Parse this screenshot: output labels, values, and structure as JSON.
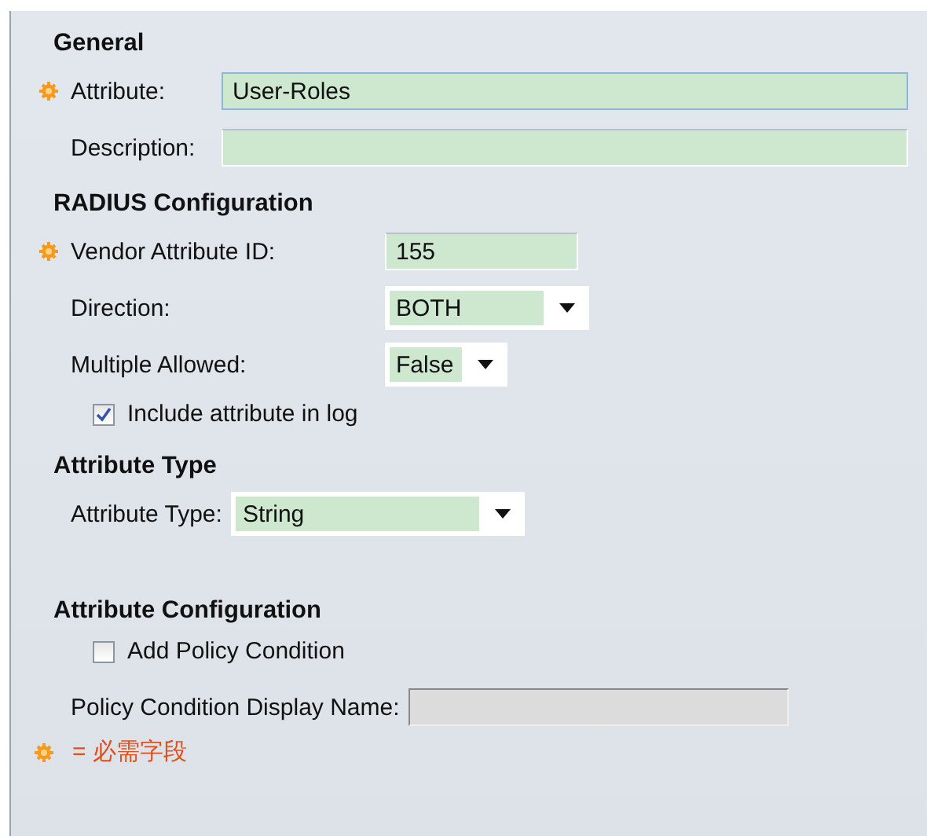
{
  "sections": [
    {
      "title": "General",
      "fields": [
        {
          "kind": "text",
          "label": "Attribute:",
          "required": true,
          "value": "User-Roles",
          "focused": true
        },
        {
          "kind": "text",
          "label": "Description:",
          "required": false
        }
      ]
    },
    {
      "title": "RADIUS Configuration",
      "fields": [
        {
          "kind": "text",
          "label": "Vendor Attribute ID:",
          "required": true,
          "value": "155"
        },
        {
          "kind": "select",
          "label": "Direction:",
          "required": false,
          "value": "BOTH"
        },
        {
          "kind": "select",
          "label": "Multiple Allowed:",
          "required": false,
          "value": "False"
        },
        {
          "kind": "checkbox",
          "label": "Include attribute in log",
          "checked": true
        }
      ]
    },
    {
      "title": "Attribute Type",
      "fields": [
        {
          "kind": "select",
          "label": "Attribute Type:",
          "required": false,
          "value": "String"
        }
      ]
    },
    {
      "title": "Attribute Configuration",
      "fields": [
        {
          "kind": "checkbox",
          "label": "Add Policy Condition",
          "checked": false
        },
        {
          "kind": "text",
          "label": "Policy Condition Display Name:",
          "required": false,
          "disabled": true
        }
      ]
    }
  ],
  "legend": {
    "text": "= 必需字段"
  }
}
